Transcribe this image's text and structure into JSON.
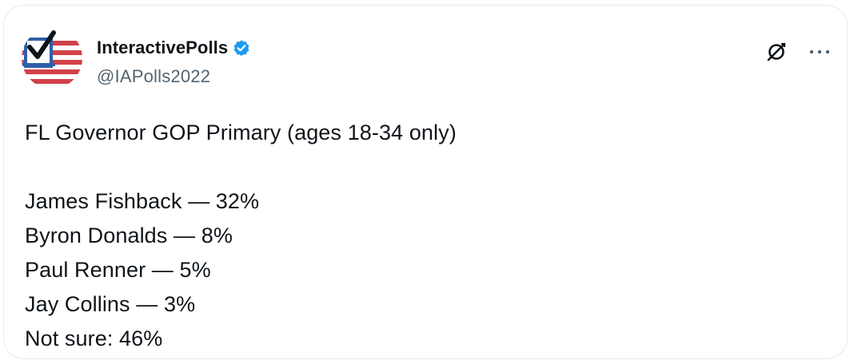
{
  "post": {
    "author": {
      "display_name": "InteractivePolls",
      "handle": "@IAPolls2022",
      "verified": true,
      "avatar_icon": "checkmark-flag-logo"
    },
    "actions": {
      "grok_icon": "grok-icon",
      "more_icon": "more-options-icon"
    },
    "text": {
      "headline": "FL Governor GOP Primary (ages 18-34 only)",
      "results": [
        "James Fishback — 32%",
        "Byron Donalds — 8%",
        "Paul Renner — 5%",
        "Jay Collins — 3%",
        "Not sure: 46%"
      ]
    }
  },
  "colors": {
    "text_primary": "#0f1419",
    "text_secondary": "#536471",
    "verified_blue": "#1d9bf0",
    "flag_red": "#d2414a",
    "flag_blue": "#2e5fa8",
    "border": "#e6e9ec"
  }
}
